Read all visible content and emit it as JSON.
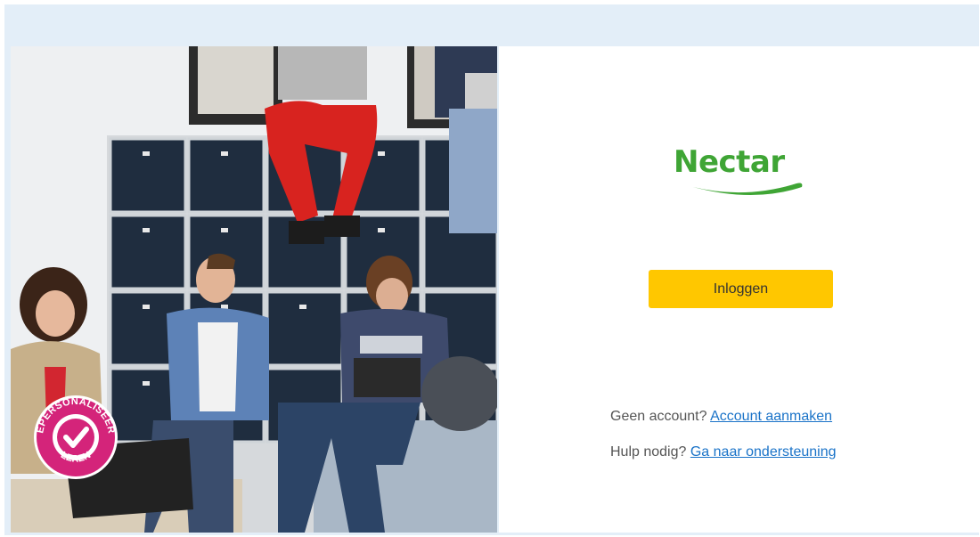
{
  "brand": {
    "logo_text": "Nectar",
    "logo_color": "#3fa535",
    "badge_text": "GEPERSONALISEERD LEREN",
    "badge_color": "#d4247a"
  },
  "login": {
    "button_label": "Inloggen",
    "button_color": "#ffc700"
  },
  "help": {
    "account_prefix": "Geen account?",
    "account_link": "Account aanmaken",
    "support_prefix": "Hulp nodig?",
    "support_link": "Ga naar ondersteuning",
    "link_color": "#1a73c8"
  }
}
